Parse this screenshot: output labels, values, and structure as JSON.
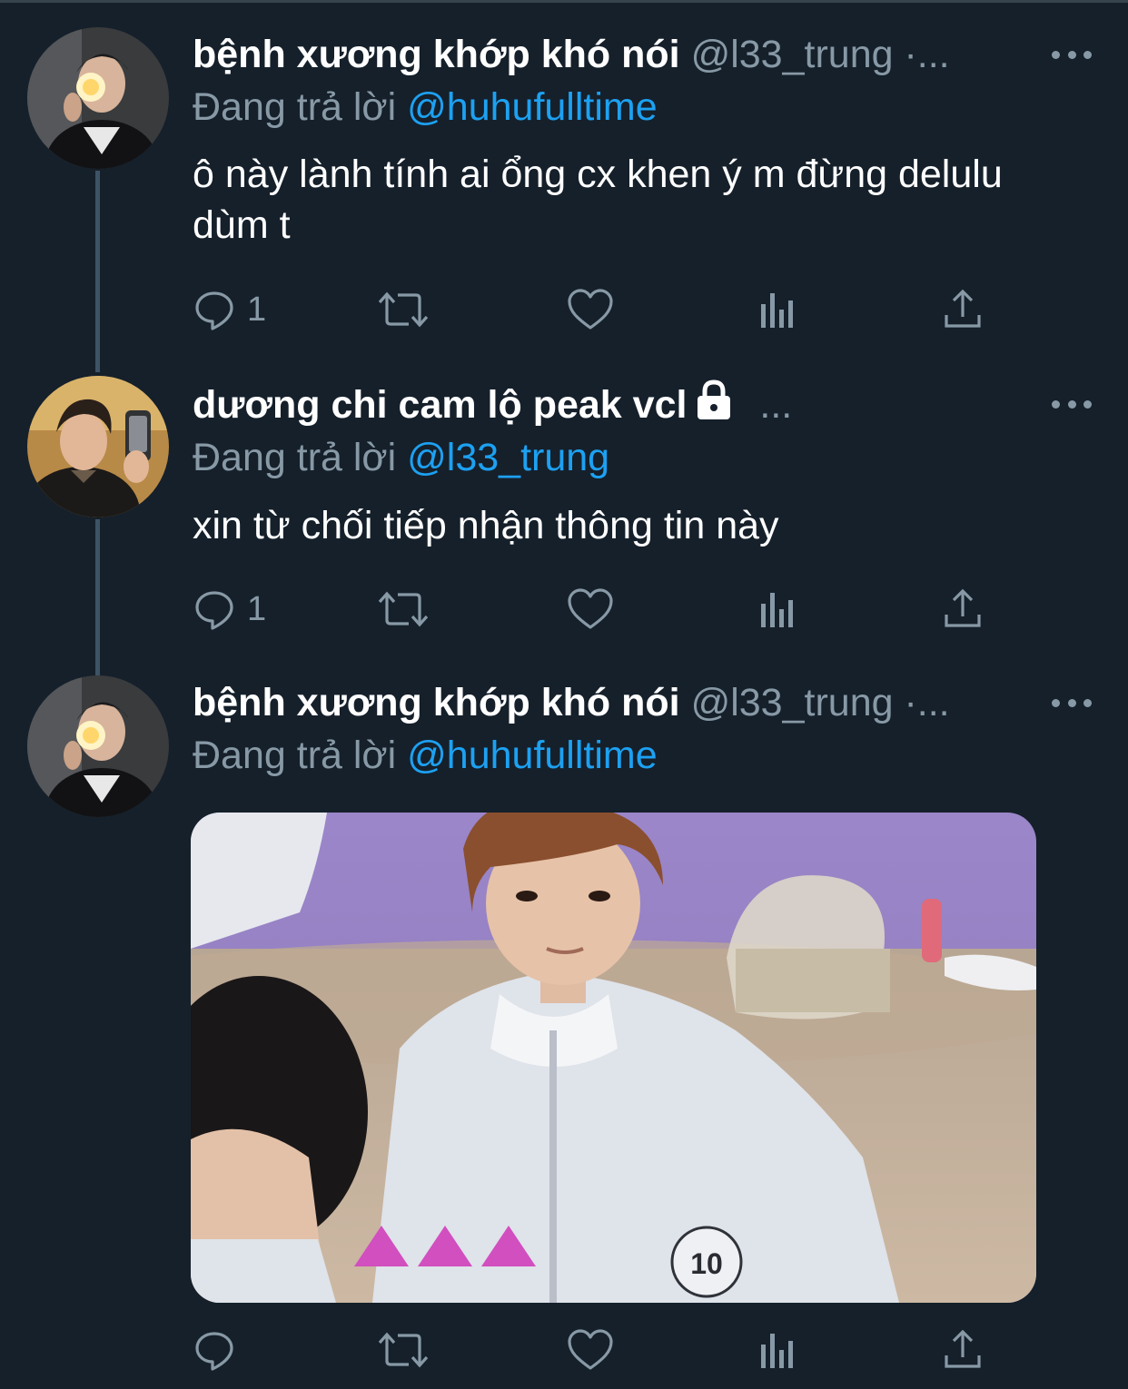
{
  "tweets": [
    {
      "display_name": "bệnh xương khớp khó nói",
      "handle": "@l33_trung ·...",
      "reply_prefix": "Đang trả lời",
      "reply_to": "@huhufulltime",
      "text": "ô này lành tính ai ổng cx khen ý m đừng delulu dùm t",
      "reply_count": "1"
    },
    {
      "display_name": "dương chi cam lộ peak vcl",
      "handle": "...",
      "reply_prefix": "Đang trả lời",
      "reply_to": "@l33_trung",
      "text": "xin từ chối tiếp nhận thông tin này",
      "reply_count": "1"
    },
    {
      "display_name": "bệnh xương khớp khó nói",
      "handle": "@l33_trung ·...",
      "reply_prefix": "Đang trả lời",
      "reply_to": "@huhufulltime",
      "text": "",
      "reply_count": "",
      "media_badge": "10"
    }
  ],
  "colors": {
    "background": "#15202b",
    "text_secondary": "#8899a6",
    "link": "#1da1f2",
    "thread_line": "#3d5466"
  },
  "icons": [
    "reply-icon",
    "retweet-icon",
    "like-icon",
    "analytics-icon",
    "share-icon",
    "more-icon",
    "lock-icon"
  ]
}
